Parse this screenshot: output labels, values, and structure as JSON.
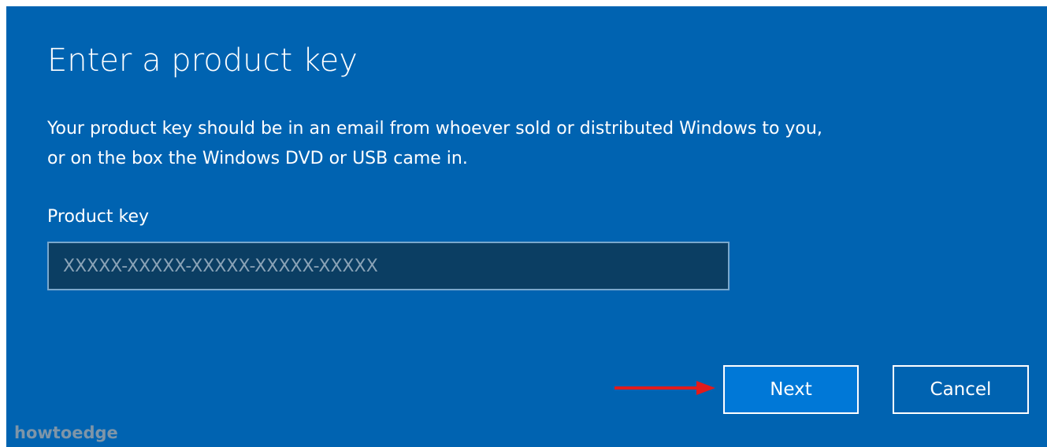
{
  "dialog": {
    "title": "Enter a product key",
    "description_line1": "Your product key should be in an email from whoever sold or distributed Windows to you,",
    "description_line2": "or on the box the Windows DVD or USB came in.",
    "field_label": "Product key",
    "input_placeholder": "XXXXX-XXXXX-XXXXX-XXXXX-XXXXX",
    "input_value": ""
  },
  "buttons": {
    "next_label": "Next",
    "cancel_label": "Cancel"
  },
  "annotation": {
    "arrow_color": "#e21b1b",
    "arrow_icon": "red-arrow-right-icon"
  },
  "watermark": {
    "text": "howtoedge"
  },
  "colors": {
    "dialog_background": "#0063b1",
    "input_background": "#0b3e63",
    "next_button_background": "#0078d7",
    "text": "#ffffff"
  }
}
